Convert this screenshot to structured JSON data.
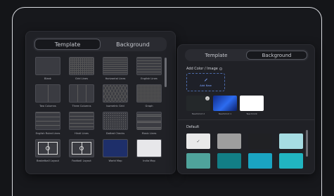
{
  "left_panel": {
    "tabs": [
      {
        "label": "Template",
        "active": true
      },
      {
        "label": "Background",
        "active": false
      }
    ],
    "templates": [
      {
        "label": "Blank",
        "pattern": "blank"
      },
      {
        "label": "Grid Lines",
        "pattern": "grid"
      },
      {
        "label": "Horizontal Lines",
        "pattern": "hlines"
      },
      {
        "label": "English Lines",
        "pattern": "eng"
      },
      {
        "label": "Two Columns",
        "pattern": "two"
      },
      {
        "label": "Three Columns",
        "pattern": "three"
      },
      {
        "label": "Isometric Grid",
        "pattern": "iso"
      },
      {
        "label": "Graph",
        "pattern": "graph"
      },
      {
        "label": "English Ruled Lines",
        "pattern": "ruled"
      },
      {
        "label": "Hindi Lines",
        "pattern": "hindi"
      },
      {
        "label": "Dotted Checks",
        "pattern": "dotted"
      },
      {
        "label": "Music Lines",
        "pattern": "music"
      },
      {
        "label": "Basketball Layout",
        "pattern": "court"
      },
      {
        "label": "Football Layout",
        "pattern": "court"
      },
      {
        "label": "World Map",
        "pattern": "world"
      },
      {
        "label": "India Map",
        "pattern": "india"
      }
    ]
  },
  "right_panel": {
    "tabs": [
      {
        "label": "Template",
        "active": false
      },
      {
        "label": "Background",
        "active": true
      }
    ],
    "add_section_label": "Add Color / Image",
    "add_new_label": "Add New",
    "uploads": [
      {
        "label": "Teachmint 2",
        "style": "dark",
        "checked": true
      },
      {
        "label": "Teachmint 1",
        "style": "blue",
        "checked": false
      },
      {
        "label": "Teachmint",
        "style": "white",
        "checked": false
      }
    ],
    "default_label": "Default",
    "default_colors": [
      "#e9e9e9",
      "#9e9e9e",
      "#202124",
      "#a6dde3",
      "#4fa39b",
      "#127e86",
      "#1aa4c2",
      "#21b5c1"
    ],
    "selected_color_index": 0
  }
}
